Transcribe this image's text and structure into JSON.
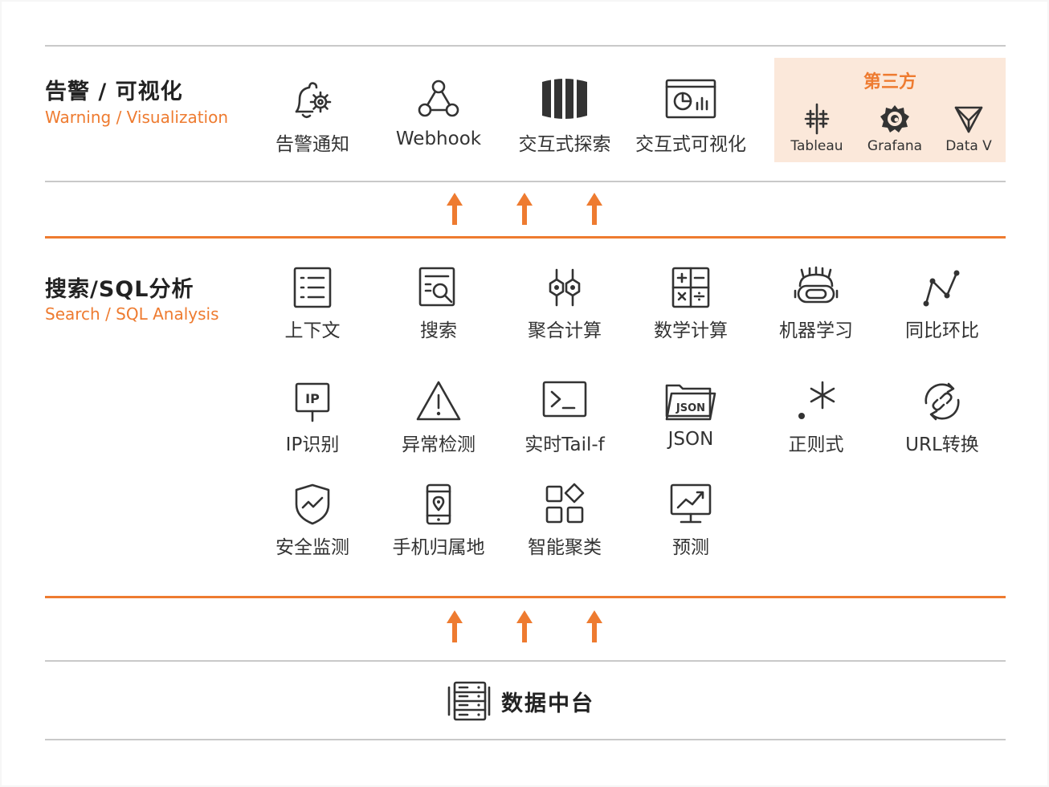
{
  "top": {
    "title": "告警 / 可视化",
    "subtitle": "Warning / Visualization",
    "items": [
      {
        "label": "告警通知",
        "icon": "bell-gear-icon"
      },
      {
        "label": "Webhook",
        "icon": "webhook-icon"
      },
      {
        "label": "交互式探索",
        "icon": "database-columns-icon"
      },
      {
        "label": "交互式可视化",
        "icon": "dashboard-chart-icon"
      }
    ],
    "third_party": {
      "title": "第三方",
      "items": [
        {
          "label": "Tableau",
          "icon": "tableau-icon"
        },
        {
          "label": "Grafana",
          "icon": "grafana-icon"
        },
        {
          "label": "Data V",
          "icon": "datav-icon"
        }
      ]
    }
  },
  "middle": {
    "title": "搜索/SQL分析",
    "subtitle": "Search / SQL Analysis",
    "items": [
      {
        "label": "上下文",
        "icon": "list-icon"
      },
      {
        "label": "搜索",
        "icon": "document-search-icon"
      },
      {
        "label": "聚合计算",
        "icon": "hexagon-nodes-icon"
      },
      {
        "label": "数学计算",
        "icon": "calculator-icon"
      },
      {
        "label": "机器学习",
        "icon": "robot-icon"
      },
      {
        "label": "同比环比",
        "icon": "line-trend-icon"
      },
      {
        "label": "IP识别",
        "icon": "ip-sign-icon"
      },
      {
        "label": "异常检测",
        "icon": "warning-triangle-icon"
      },
      {
        "label": "实时Tail-f",
        "icon": "terminal-icon"
      },
      {
        "label": "JSON",
        "icon": "json-folder-icon"
      },
      {
        "label": "正则式",
        "icon": "regex-icon"
      },
      {
        "label": "URL转换",
        "icon": "link-cycle-icon"
      },
      {
        "label": "安全监测",
        "icon": "shield-pulse-icon"
      },
      {
        "label": "手机归属地",
        "icon": "phone-location-icon"
      },
      {
        "label": "智能聚类",
        "icon": "cluster-grid-icon"
      },
      {
        "label": "预测",
        "icon": "monitor-trend-icon"
      }
    ]
  },
  "bottom": {
    "label": "数据中台",
    "icon": "server-rack-icon"
  },
  "colors": {
    "accent": "#ee7b30",
    "third_party_bg": "#fbe8da",
    "divider": "#c9c9c9",
    "text": "#333333"
  }
}
